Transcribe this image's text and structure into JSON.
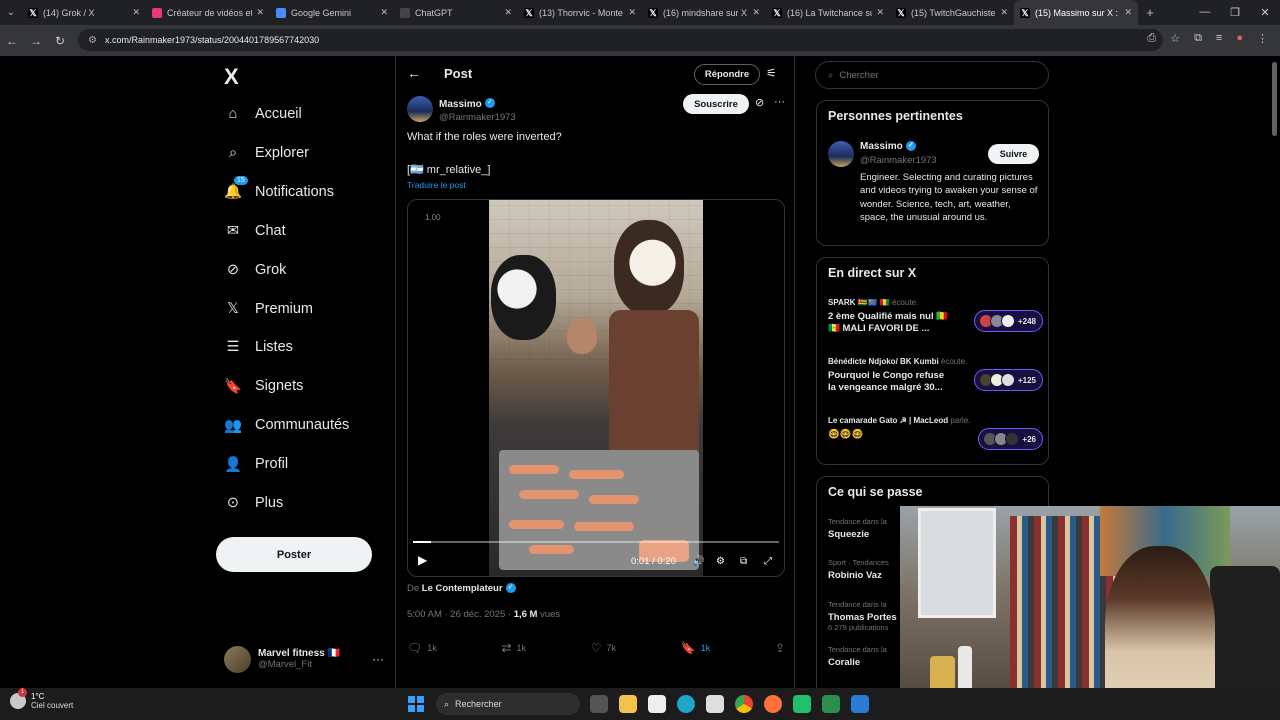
{
  "browser": {
    "tabs": [
      {
        "title": "(14) Grok / X",
        "icon": "x-icon",
        "color": "#000000"
      },
      {
        "title": "Créateur de vidéos et",
        "icon": "app-icon",
        "color": "#e53974"
      },
      {
        "title": "Google Gemini",
        "icon": "gemini-icon",
        "color": "#4a8cff"
      },
      {
        "title": "ChatGPT",
        "icon": "chatgpt-icon",
        "color": "#444444"
      },
      {
        "title": "(13) Thorrvic - Monte",
        "icon": "x-icon",
        "color": "#000000"
      },
      {
        "title": "(16) mindshare sur X",
        "icon": "x-icon",
        "color": "#000000"
      },
      {
        "title": "(16) La Twitchance su",
        "icon": "x-icon",
        "color": "#000000"
      },
      {
        "title": "(15) TwitchGauchiste",
        "icon": "x-icon",
        "color": "#000000"
      },
      {
        "title": "(15) Massimo sur X :",
        "icon": "x-icon",
        "color": "#000000"
      }
    ],
    "url": "x.com/Rainmaker1973/status/2004401789567742030"
  },
  "sidebar": {
    "logo": "X",
    "items": [
      {
        "label": "Accueil",
        "icon": "home-icon"
      },
      {
        "label": "Explorer",
        "icon": "search-icon"
      },
      {
        "label": "Notifications",
        "icon": "bell-icon",
        "badge": "15"
      },
      {
        "label": "Chat",
        "icon": "mail-icon"
      },
      {
        "label": "Grok",
        "icon": "grok-icon"
      },
      {
        "label": "Premium",
        "icon": "x-premium-icon"
      },
      {
        "label": "Listes",
        "icon": "list-icon"
      },
      {
        "label": "Signets",
        "icon": "bookmark-icon"
      },
      {
        "label": "Communautés",
        "icon": "communities-icon"
      },
      {
        "label": "Profil",
        "icon": "profile-icon"
      },
      {
        "label": "Plus",
        "icon": "more-circle-icon"
      }
    ],
    "post_button": "Poster",
    "account": {
      "name": "Marvel fitness 🇫🇷",
      "handle": "@Marvel_Fit"
    }
  },
  "post": {
    "header_title": "Post",
    "reply_button": "Répondre",
    "author_name": "Massimo",
    "author_handle": "@Rainmaker1973",
    "follow_button": "Souscrire",
    "text_line1": "What if the roles were inverted?",
    "text_line2": "[🇦🇷 mr_relative_]",
    "translate": "Traduire le post",
    "video": {
      "speed": "1.00",
      "time": "0:01 / 0:20",
      "progress": 0.05
    },
    "attribution_prefix": "De ",
    "attribution_name": "Le Contemplateur",
    "meta_time": "5:00 AM · 26 déc. 2025 · ",
    "meta_views": "1,6 M",
    "meta_views_suffix": " vues",
    "actions": [
      {
        "icon": "reply-icon",
        "count": "1k"
      },
      {
        "icon": "repost-icon",
        "count": "1k"
      },
      {
        "icon": "like-icon",
        "count": "7k"
      },
      {
        "icon": "bookmark-icon",
        "count": "1k"
      },
      {
        "icon": "share-icon",
        "count": ""
      }
    ]
  },
  "right": {
    "search_placeholder": "Chercher",
    "relevant": {
      "title": "Personnes pertinentes",
      "name": "Massimo",
      "handle": "@Rainmaker1973",
      "follow": "Suivre",
      "bio": "Engineer. Selecting and curating pictures and videos trying to awaken your sense of wonder. Science, tech, art, weather, space, the unusual around us."
    },
    "live": {
      "title": "En direct sur X",
      "items": [
        {
          "host": "SPARK 🇹🇬🇨🇩 🇬🇳",
          "status": " écoute.",
          "title": "2 ème Qualifié mais nul 🇲🇱🇸🇳 MALI FAVORI DE ...",
          "listeners": "+248"
        },
        {
          "host": "Bénédicte Ndjoko/ BK Kumbi",
          "status": " écoute.",
          "title": "Pourquoi le Congo refuse la vengeance malgré 30...",
          "listeners": "+125"
        },
        {
          "host": "Le camarade Gato ☭ | MacLeod",
          "status": " parle.",
          "title": "🤓🤓🤓",
          "listeners": "+26"
        }
      ]
    },
    "trends": {
      "title": "Ce qui se passe",
      "items": [
        {
          "context": "Tendance dans la",
          "name": "Squeezie",
          "extra": ""
        },
        {
          "context": "Sport · Tendances",
          "name": "Robinio Vaz",
          "extra": ""
        },
        {
          "context": "Tendance dans la",
          "name": "Thomas Portes",
          "extra": "6 279 publications"
        },
        {
          "context": "Tendance dans la",
          "name": "Coralie",
          "extra": ""
        }
      ]
    }
  },
  "taskbar": {
    "temperature": "1°C",
    "weather": "Ciel couvert",
    "weather_badge": "1",
    "search": "Rechercher"
  }
}
